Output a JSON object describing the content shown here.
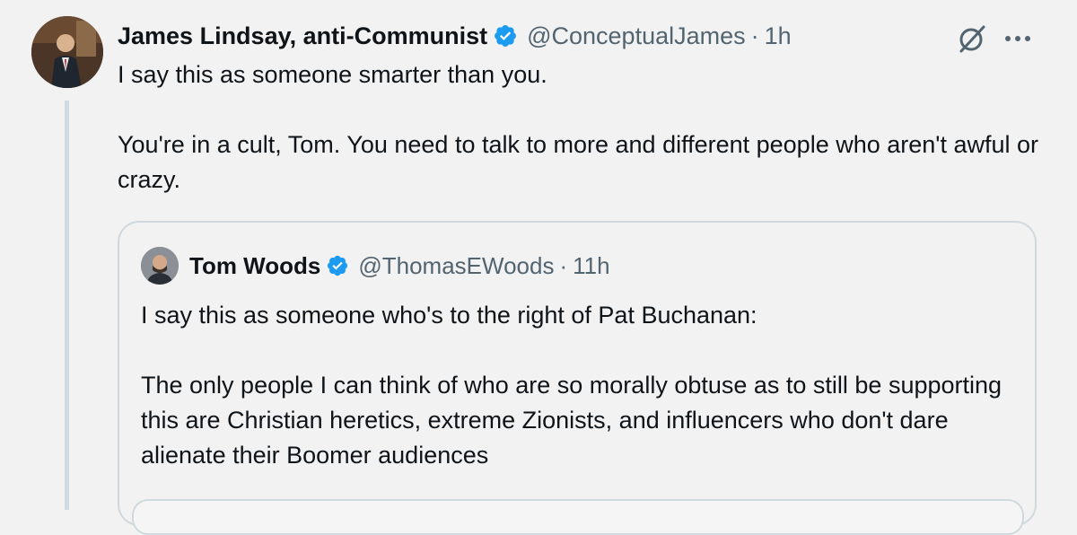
{
  "post": {
    "author": {
      "name": "James Lindsay, anti-Communist",
      "handle": "@ConceptualJames",
      "time": "1h",
      "dot": "·"
    },
    "paragraphs": [
      "I say this as someone smarter than you.",
      "You're in a cult, Tom. You need to talk to more and different people who aren't awful or crazy."
    ],
    "icons": [
      "grok-icon",
      "more-icon",
      "verified-badge-icon"
    ]
  },
  "quote": {
    "author": {
      "name": "Tom Woods",
      "handle": "@ThomasEWoods",
      "time": "11h",
      "dot": "·"
    },
    "paragraphs": [
      "I say this as someone who's to the right of Pat Buchanan:",
      "The only people I can think of who are so morally obtuse as to still be supporting this are Christian heretics, extreme Zionists, and influencers who don't dare alienate their Boomer audiences"
    ]
  },
  "colors": {
    "background": "#f2f2f2",
    "text": "#0f1419",
    "secondary_text": "#536471",
    "verified_blue": "#1d9bf0",
    "border": "#cfd9de"
  }
}
